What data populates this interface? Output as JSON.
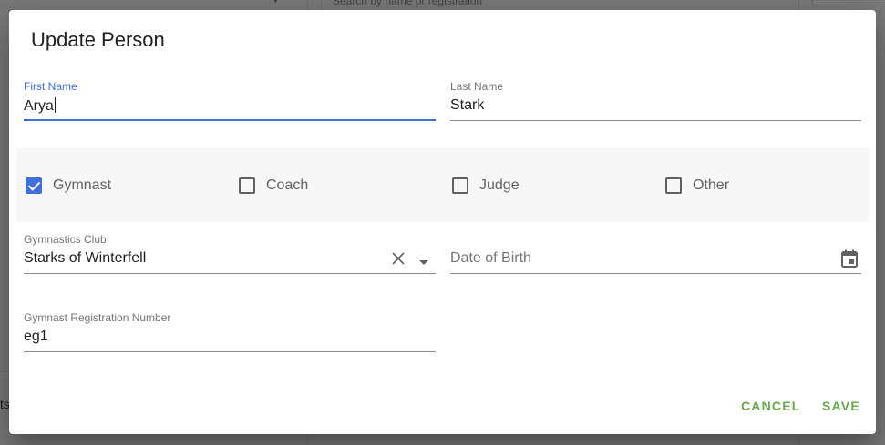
{
  "background": {
    "search_placeholder": "Search by name or registration",
    "left_edge_text": "ts"
  },
  "dialog": {
    "title": "Update Person",
    "first_name": {
      "label": "First Name",
      "value": "Arya"
    },
    "last_name": {
      "label": "Last Name",
      "value": "Stark"
    },
    "roles": [
      {
        "label": "Gymnast",
        "checked": true
      },
      {
        "label": "Coach",
        "checked": false
      },
      {
        "label": "Judge",
        "checked": false
      },
      {
        "label": "Other",
        "checked": false
      }
    ],
    "club": {
      "label": "Gymnastics Club",
      "value": "Starks of Winterfell"
    },
    "dob": {
      "placeholder": "Date of Birth"
    },
    "registration": {
      "label": "Gymnast Registration Number",
      "value": "eg1"
    },
    "actions": {
      "cancel": "CANCEL",
      "save": "SAVE"
    }
  },
  "colors": {
    "accent": "#3f6fd8",
    "action": "#6aa84f"
  },
  "icons": {
    "clear": "close-icon",
    "dropdown": "caret-down-icon",
    "calendar": "calendar-icon"
  }
}
